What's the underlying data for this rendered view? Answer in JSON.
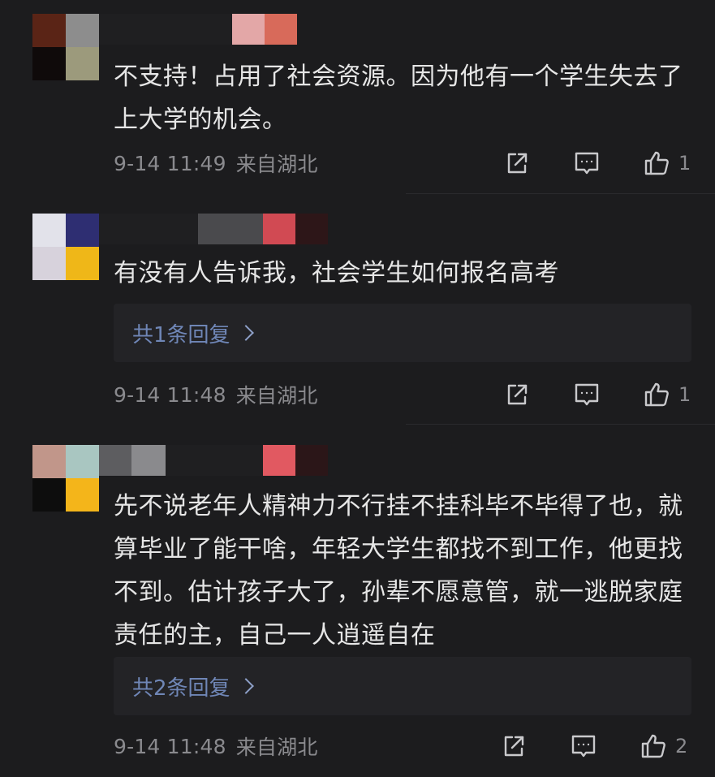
{
  "comments": [
    {
      "text": "不支持！占用了社会资源。因为他有一个学生失去了上大学的机会。",
      "time": "9-14 11:49",
      "location": "来自湖北",
      "likes": "1",
      "reply_label": ""
    },
    {
      "text": "有没有人告诉我，社会学生如何报名高考",
      "time": "9-14 11:48",
      "location": "来自湖北",
      "likes": "1",
      "reply_label": "共1条回复"
    },
    {
      "text": "先不说老年人精神力不行挂不挂科毕不毕得了也，就算毕业了能干啥，年轻大学生都找不到工作，他更找不到。估计孩子大了，孙辈不愿意管，就一逃脱家庭责任的主，自己一人逍遥自在",
      "time": "9-14 11:48",
      "location": "来自湖北",
      "likes": "2",
      "reply_label": "共2条回复"
    }
  ],
  "icons": {
    "share": "share-icon",
    "reply": "comment-icon",
    "like": "thumbs-up-icon",
    "reply_chevron": "chevron-right-icon"
  },
  "colors": {
    "background": "#1c1c1e",
    "text": "#e6e6e6",
    "meta": "#8a8a8e",
    "reply_link": "#6f86b6",
    "reply_box": "#232326"
  }
}
